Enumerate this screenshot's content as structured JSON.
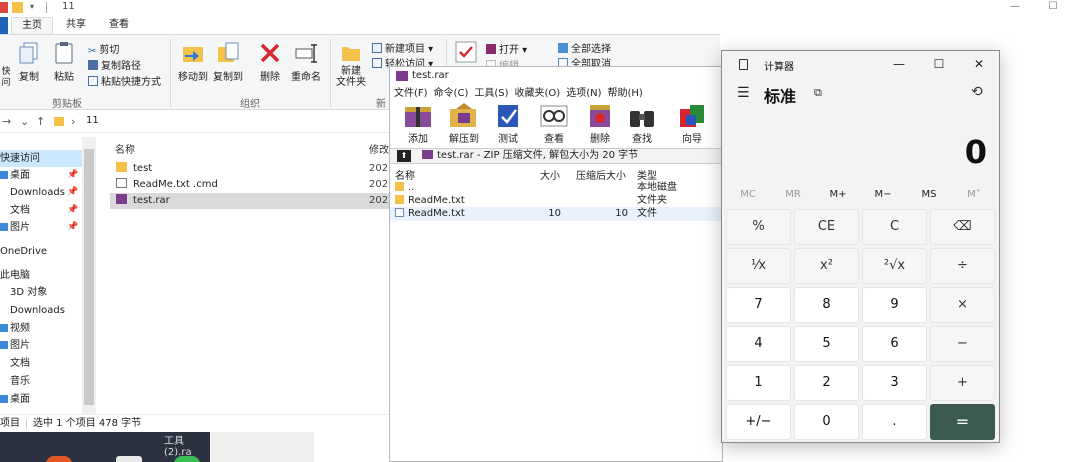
{
  "explorer": {
    "title": "11",
    "tabs": {
      "home": "主页",
      "share": "共享",
      "view": "查看"
    },
    "ribbon": {
      "pin_quick": "快\n问",
      "copy": "复制",
      "paste": "粘贴",
      "cut": "剪切",
      "copy_path": "复制路径",
      "paste_shortcut": "粘贴快捷方式",
      "move_to": "移动到",
      "copy_to": "复制到",
      "delete": "删除",
      "rename": "重命名",
      "new_folder": "新建\n文件夹",
      "new_item": "新建项目 ▾",
      "easy_access": "轻松访问 ▾",
      "open": "打开 ▾",
      "edit": "编辑",
      "select_all": "全部选择",
      "select_none": "全部取消",
      "group_clipboard": "剪贴板",
      "group_organize": "组织",
      "group_new": "新"
    },
    "address": {
      "path": "11"
    },
    "nav": [
      {
        "label": "快速访问",
        "pinned": false
      },
      {
        "label": "桌面",
        "pinned": true
      },
      {
        "label": "Downloads",
        "pinned": true
      },
      {
        "label": "文档",
        "pinned": true
      },
      {
        "label": "图片",
        "pinned": true
      },
      {
        "label": "OneDrive",
        "pinned": false
      },
      {
        "label": "此电脑",
        "pinned": false
      },
      {
        "label": "3D 对象",
        "pinned": false
      },
      {
        "label": "Downloads",
        "pinned": false
      },
      {
        "label": "视频",
        "pinned": false
      },
      {
        "label": "图片",
        "pinned": false
      },
      {
        "label": "文档",
        "pinned": false
      },
      {
        "label": "音乐",
        "pinned": false
      },
      {
        "label": "桌面",
        "pinned": false
      }
    ],
    "columns": {
      "name": "名称",
      "modified": "修改"
    },
    "files": [
      {
        "name": "test",
        "date": "202"
      },
      {
        "name": "ReadMe.txt .cmd",
        "date": "202"
      },
      {
        "name": "test.rar",
        "date": "202"
      }
    ],
    "status": {
      "items": "项目",
      "selected": "选中 1 个项目  478 字节"
    },
    "desktop_label": "工具(2).ra"
  },
  "winrar": {
    "title": "test.rar",
    "menu": [
      "文件(F)",
      "命令(C)",
      "工具(S)",
      "收藏夹(O)",
      "选项(N)",
      "帮助(H)"
    ],
    "tools": [
      "添加",
      "解压到",
      "测试",
      "查看",
      "删除",
      "查找",
      "向导"
    ],
    "path_text": "test.rar - ZIP 压缩文件, 解包大小为 20 字节",
    "headers": {
      "name": "名称",
      "size": "大小",
      "packed": "压缩后大小",
      "type": "类型"
    },
    "rows": [
      {
        "name": "..",
        "size": "",
        "packed": "",
        "type": "本地磁盘"
      },
      {
        "name": "ReadMe.txt",
        "size": "",
        "packed": "",
        "type": "文件夹"
      },
      {
        "name": "ReadMe.txt",
        "size": "10",
        "packed": "10",
        "type": "文件"
      }
    ]
  },
  "calculator": {
    "title": "计算器",
    "mode": "标准",
    "display": "0",
    "memory": [
      "MC",
      "MR",
      "M+",
      "M−",
      "MS",
      "M˅"
    ],
    "keys": [
      [
        "%",
        "CE",
        "C",
        "⌫"
      ],
      [
        "¹⁄x",
        "x²",
        "²√x",
        "÷"
      ],
      [
        "7",
        "8",
        "9",
        "×"
      ],
      [
        "4",
        "5",
        "6",
        "−"
      ],
      [
        "1",
        "2",
        "3",
        "+"
      ],
      [
        "+/−",
        "0",
        ".",
        "="
      ]
    ]
  }
}
